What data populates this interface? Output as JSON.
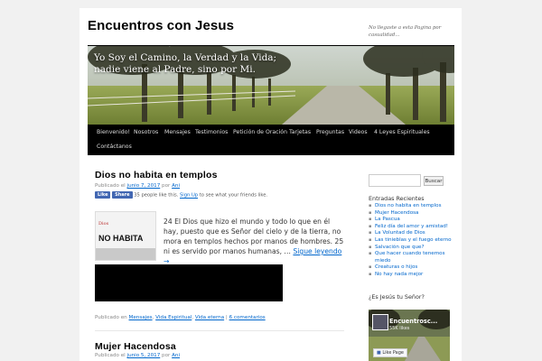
{
  "header": {
    "site_title": "Encuentros con Jesus",
    "site_description": "No llegaste a esta Pagina por casualidad..."
  },
  "banner": {
    "quote_line1": "Yo Soy el Camino, la Verdad y la Vida;",
    "quote_line2": "nadie viene al Padre, sino por Mi."
  },
  "nav": {
    "items": [
      "Bienvenido!",
      "Nosotros",
      "Mensajes",
      "Testimonios",
      "Petición de Oración",
      "Tarjetas",
      "Preguntas",
      "Videos",
      "4 Leyes Espirituales",
      "Contáctanos"
    ]
  },
  "posts": [
    {
      "title": "Dios no habita en templos",
      "meta_prefix": "Publicado el",
      "date": "junio 7, 2017",
      "meta_by": "por",
      "author": "Ani",
      "fb_like": "Like",
      "fb_share": "Share",
      "fb_text": "35 people like this.",
      "fb_signup": "Sign Up",
      "fb_text2": "to see what your friends like.",
      "thumb_small": "Dios",
      "thumb_text": "NO HABITA",
      "excerpt": "24 El Dios que hizo el mundo y todo lo que en él hay, puesto que es Señor del cielo y de la tierra, no mora en templos hechos por manos de hombres. 25 ni es servido por manos humanas, …",
      "read_more": "Sigue leyendo →",
      "footer_prefix": "Publicado en",
      "cat1": "Mensajes",
      "cat2": "Vida Espiritual",
      "cat3": "Vida eterna",
      "comments": "6 comentarios"
    },
    {
      "title": "Mujer Hacendosa",
      "meta_prefix": "Publicado el",
      "date": "junio 5, 2017",
      "meta_by": "por",
      "author": "Ani"
    }
  ],
  "sidebar": {
    "search_placeholder": "",
    "search_button": "Buscar",
    "recent_title": "Entradas Recientes",
    "recent": [
      "Dios no habita en templos",
      "Mujer Hacendosa",
      "La Pascua",
      "Feliz día del amor y amistad!",
      "La Voluntad de Dios",
      "Las tinieblas y el fuego eterno",
      "Salvación que que?",
      "Que hacer cuando tenemos miedo",
      "Creaturas o hijos",
      "No hay nada mejor"
    ],
    "widget2_title": "¿Es Jesús tu Señor?",
    "fb_page_name": "Encuentrosc...",
    "fb_page_likes": "55K likes",
    "fb_like_page": "Like Page"
  },
  "colors": {
    "link": "#0066cc",
    "nav_bg": "#000000",
    "fb_blue": "#4267b2"
  }
}
